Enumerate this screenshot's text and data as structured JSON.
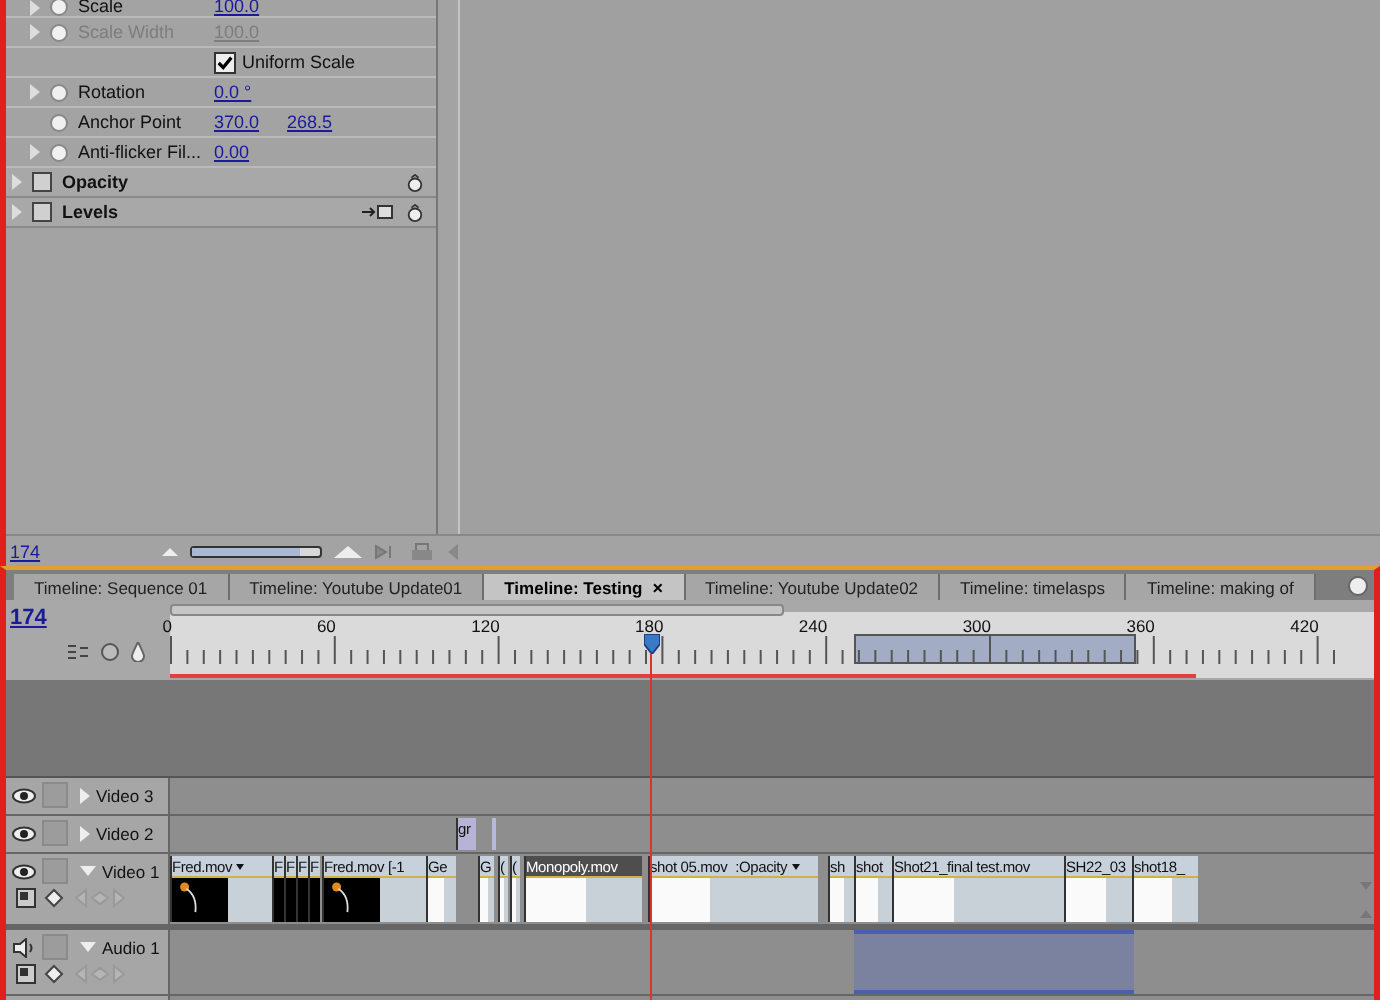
{
  "effect_controls": {
    "rows": [
      {
        "kind": "param",
        "name": "Scale",
        "values": [
          "100.0"
        ],
        "disabled": false,
        "expandable": true
      },
      {
        "kind": "param",
        "name": "Scale Width",
        "values": [
          "100.0"
        ],
        "disabled": true,
        "expandable": true
      },
      {
        "kind": "checkbox",
        "name": "Uniform Scale",
        "checked": true
      },
      {
        "kind": "param",
        "name": "Rotation",
        "values": [
          "0.0 °"
        ],
        "disabled": false,
        "expandable": true
      },
      {
        "kind": "param",
        "name": "Anchor Point",
        "values": [
          "370.0",
          "268.5"
        ],
        "disabled": false,
        "expandable": false
      },
      {
        "kind": "param",
        "name": "Anti-flicker Fil...",
        "values": [
          "0.00"
        ],
        "disabled": false,
        "expandable": true
      },
      {
        "kind": "section",
        "name": "Opacity",
        "keyframe_nav": false
      },
      {
        "kind": "section",
        "name": "Levels",
        "keyframe_nav": true
      }
    ],
    "timecode": "174",
    "zoom": {
      "level": 0.85
    }
  },
  "timeline": {
    "tabs": [
      {
        "label": "Timeline: Sequence 01",
        "selected": false
      },
      {
        "label": "Timeline: Youtube Update01",
        "selected": false
      },
      {
        "label": "Timeline: Testing",
        "selected": true,
        "close": "×"
      },
      {
        "label": "Timeline: Youtube Update02",
        "selected": false
      },
      {
        "label": "Timeline: timelasps",
        "selected": false
      },
      {
        "label": "Timeline: making of",
        "selected": false
      }
    ],
    "timecode": "174",
    "ruler_labels": [
      "0",
      "60",
      "120",
      "180",
      "240",
      "300",
      "360",
      "420"
    ],
    "tracks": [
      {
        "kind": "video",
        "name": "Video 3",
        "expanded": false
      },
      {
        "kind": "video",
        "name": "Video 2",
        "expanded": false,
        "clips": [
          {
            "name": "gr",
            "kind": "plain",
            "selected": false
          }
        ]
      },
      {
        "kind": "video",
        "name": "Video 1",
        "expanded": true,
        "clips": [
          {
            "name": "Fred.mov",
            "menu": true,
            "kind": "dark",
            "selected": false
          },
          {
            "name": "F",
            "kind": "dark",
            "selected": false
          },
          {
            "name": "F",
            "kind": "dark",
            "selected": false
          },
          {
            "name": "F",
            "kind": "dark",
            "selected": false
          },
          {
            "name": "F",
            "kind": "dark",
            "selected": false
          },
          {
            "name": "Fred.mov [-1",
            "kind": "dark",
            "selected": false
          },
          {
            "name": "Ge",
            "kind": "light",
            "selected": false
          },
          {
            "name": "G",
            "kind": "light",
            "selected": false
          },
          {
            "name": "(",
            "kind": "light",
            "selected": false
          },
          {
            "name": "(",
            "kind": "light",
            "selected": false
          },
          {
            "name": "Monopoly.mov",
            "kind": "light",
            "selected": true
          },
          {
            "name": "shot 05.mov",
            "effect": ":Opacity",
            "menu": true,
            "kind": "light",
            "selected": false
          },
          {
            "name": "sh",
            "kind": "light",
            "selected": false
          },
          {
            "name": "shot",
            "kind": "light",
            "selected": false
          },
          {
            "name": "Shot21_final test.mov",
            "kind": "light",
            "selected": false
          },
          {
            "name": "SH22_03",
            "kind": "light",
            "selected": false
          },
          {
            "name": "shot18_",
            "kind": "light",
            "selected": false
          }
        ]
      },
      {
        "kind": "audio",
        "name": "Audio 1",
        "expanded": true
      }
    ]
  }
}
